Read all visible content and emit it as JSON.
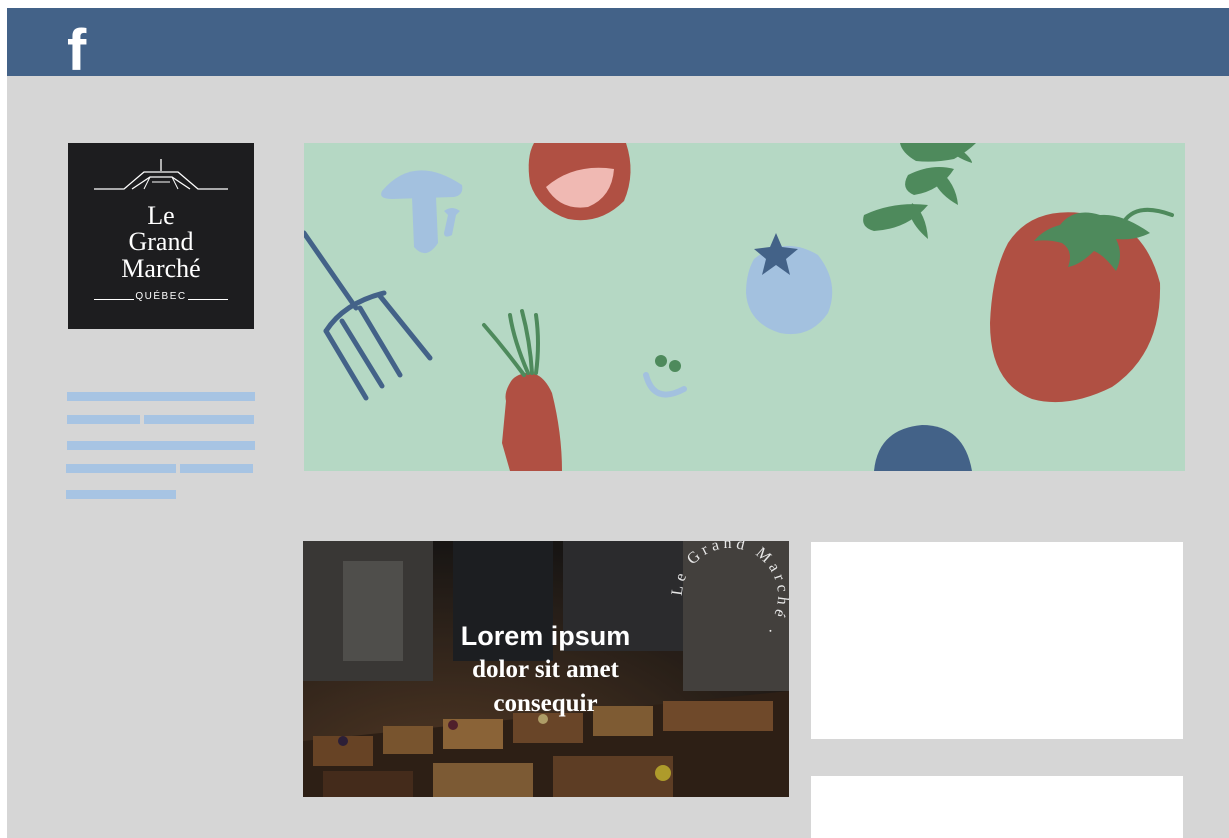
{
  "header": {
    "brand_icon": "facebook-icon",
    "brand_glyph": "f",
    "color": "#436288"
  },
  "logo": {
    "word1": "Le",
    "word2": "Grand",
    "word3": "Marché",
    "sub": "QUÉBEC"
  },
  "post": {
    "line1": "Lorem ipsum",
    "line2": "dolor sit amet",
    "line3": "consequir",
    "circular_text": "Le Grand Marché ·"
  },
  "colors": {
    "page_bg": "#d6d6d6",
    "placeholder_text": "#a7c4e3",
    "banner_bg": "#b5d8c4",
    "tomato_red": "#b05043",
    "mushroom_blue": "#a3c1df",
    "leaf_green": "#4e8a5c",
    "navy": "#436288"
  }
}
